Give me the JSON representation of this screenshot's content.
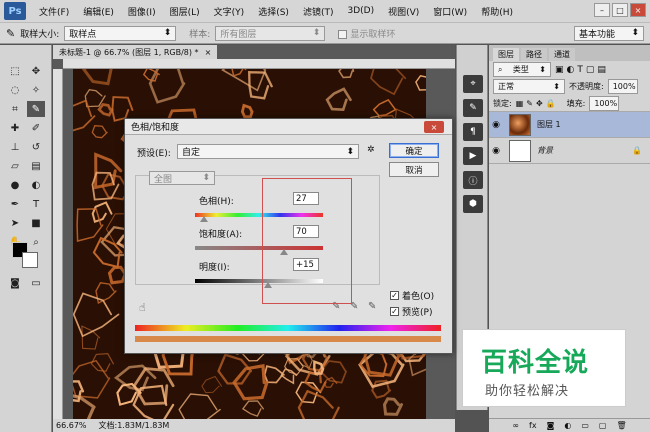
{
  "menubar": {
    "logo": "Ps",
    "items": [
      "文件(F)",
      "编辑(E)",
      "图像(I)",
      "图层(L)",
      "文字(Y)",
      "选择(S)",
      "滤镜(T)",
      "3D(D)",
      "视图(V)",
      "窗口(W)",
      "帮助(H)"
    ]
  },
  "options": {
    "sample_size_label": "取样大小:",
    "sample_size_value": "取样点",
    "sample_label": "样本:",
    "sample_value": "所有图层",
    "show_ring_label": "显示取样环",
    "workspace": "基本功能"
  },
  "document": {
    "tab_title": "未标题-1 @ 66.7% (图层 1, RGB/8) *",
    "tab_close": "×",
    "zoom": "66.67%",
    "doc_info": "文档:1.83M/1.83M"
  },
  "layers_panel": {
    "tabs": [
      "图层",
      "路径",
      "通道"
    ],
    "kind_label": "类型",
    "blend_mode": "正常",
    "opacity_label": "不透明度:",
    "opacity_value": "100%",
    "lock_label": "锁定:",
    "fill_label": "填充:",
    "fill_value": "100%",
    "layers": [
      {
        "name": "图层 1",
        "selected": true
      },
      {
        "name": "背景",
        "selected": false
      }
    ]
  },
  "dialog": {
    "title": "色相/饱和度",
    "preset_label": "预设(E):",
    "preset_value": "自定",
    "channel_value": "全图",
    "ok_label": "确定",
    "cancel_label": "取消",
    "hue_label": "色相(H):",
    "hue_value": "27",
    "saturation_label": "饱和度(A):",
    "saturation_value": "70",
    "lightness_label": "明度(I):",
    "lightness_value": "+15",
    "colorize_label": "着色(O)",
    "colorize_checked": true,
    "preview_label": "预览(P)",
    "preview_checked": true,
    "close_label": "×"
  },
  "watermark": {
    "title": "百科全说",
    "subtitle": "助你轻松解决"
  },
  "colors": {
    "accent_red": "#c94a3a",
    "watermark_green": "#17a85a",
    "canvas_orange": "#e09050"
  }
}
